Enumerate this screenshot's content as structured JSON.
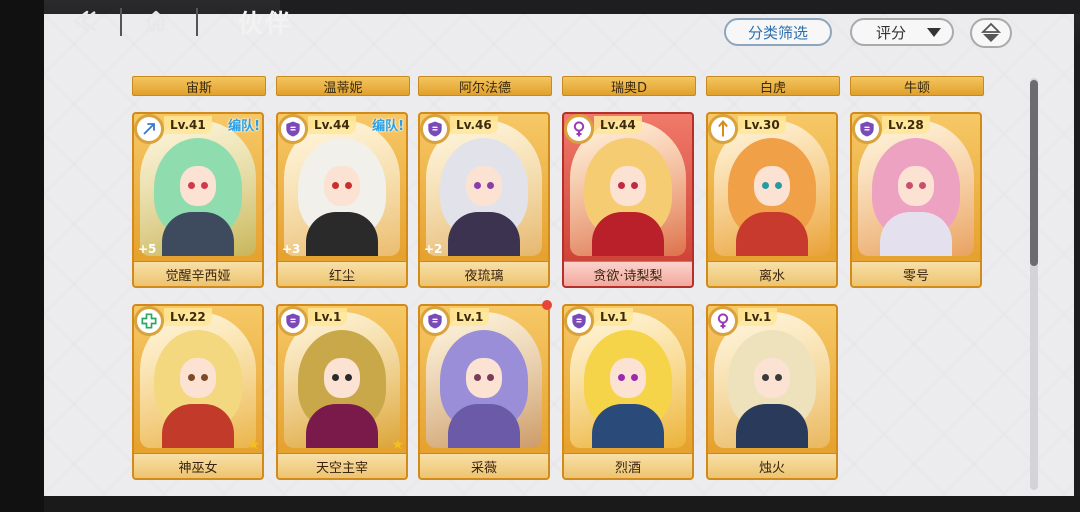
{
  "header": {
    "title": "伙伴"
  },
  "toolbar": {
    "filter_label": "分类筛选",
    "sort_label": "评分"
  },
  "top_names": [
    "宙斯",
    "温蒂妮",
    "阿尔法德",
    "瑞奥D",
    "白虎",
    "牛顿"
  ],
  "cards": [
    {
      "name": "觉醒辛西娅",
      "level": "Lv.41",
      "team": "编队!",
      "plus": "+5",
      "icon": "bow-icon",
      "hair": "#8fdcae",
      "body": "#3e4a5e",
      "eye": "#d03a4a",
      "red": false,
      "star": false
    },
    {
      "name": "红尘",
      "level": "Lv.44",
      "team": "编队!",
      "plus": "+3",
      "icon": "shield-icon",
      "hair": "#f2f0ea",
      "body": "#2a2a2a",
      "eye": "#c8302e",
      "red": false,
      "star": false
    },
    {
      "name": "夜琉璃",
      "level": "Lv.46",
      "team": "",
      "plus": "+2",
      "icon": "shield-icon",
      "hair": "#e2e2ea",
      "body": "#3b3350",
      "eye": "#8a3ea8",
      "red": false,
      "star": false
    },
    {
      "name": "贪欲·诗梨梨",
      "level": "Lv.44",
      "team": "",
      "plus": "",
      "icon": "venus-icon",
      "hair": "#f6cc72",
      "body": "#b9202a",
      "eye": "#c02a44",
      "red": true,
      "star": false
    },
    {
      "name": "离水",
      "level": "Lv.30",
      "team": "",
      "plus": "",
      "icon": "arrow-icon",
      "hair": "#f0a046",
      "body": "#c83a2e",
      "eye": "#2a9aa0",
      "red": false,
      "star": false
    },
    {
      "name": "零号",
      "level": "Lv.28",
      "team": "",
      "plus": "",
      "icon": "shield-icon",
      "hair": "#eea2c2",
      "body": "#e4e0ee",
      "eye": "#c8506e",
      "red": false,
      "star": false
    },
    {
      "name": "神巫女",
      "level": "Lv.22",
      "team": "",
      "plus": "",
      "icon": "cross-icon",
      "hair": "#f3d880",
      "body": "#c23a2a",
      "eye": "#7a4a2a",
      "red": false,
      "star": true
    },
    {
      "name": "天空主宰",
      "level": "Lv.1",
      "team": "",
      "plus": "",
      "icon": "shield-icon",
      "hair": "#c8a848",
      "body": "#7a1a4a",
      "eye": "#2a2a2a",
      "red": false,
      "star": true
    },
    {
      "name": "采薇",
      "level": "Lv.1",
      "team": "",
      "plus": "",
      "icon": "shield-icon",
      "hair": "#9a8ed8",
      "body": "#6a5aa8",
      "eye": "#7a3a5a",
      "red": false,
      "star": false
    },
    {
      "name": "烈酒",
      "level": "Lv.1",
      "team": "",
      "plus": "",
      "icon": "shield-icon",
      "hair": "#f6d44a",
      "body": "#2a4a7a",
      "eye": "#9a2ab0",
      "red": false,
      "star": false
    },
    {
      "name": "烛火",
      "level": "Lv.1",
      "team": "",
      "plus": "",
      "icon": "venus-icon",
      "hair": "#eee2bc",
      "body": "#2a3a5a",
      "eye": "#3a3a3a",
      "red": false,
      "star": false
    }
  ]
}
